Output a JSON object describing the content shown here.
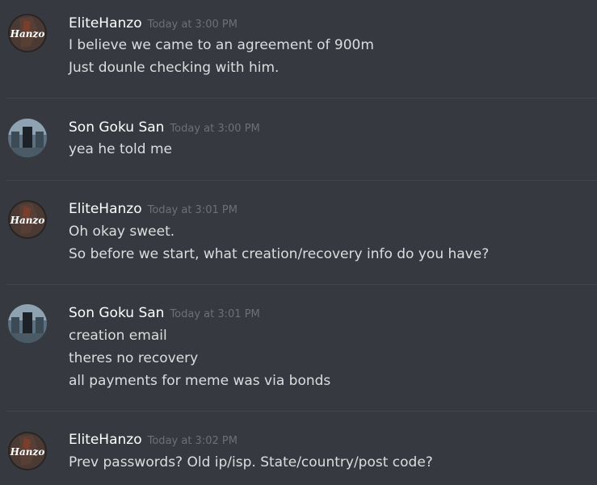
{
  "messages": [
    {
      "author": "EliteHanzo",
      "avatar_icon": "hanzo-avatar",
      "avatar_text": "Hanzo",
      "timestamp": "Today at 3:00 PM",
      "lines": [
        "I believe we came to an agreement of 900m",
        "Just dounle checking with him."
      ]
    },
    {
      "author": "Son Goku San",
      "avatar_icon": "goku-avatar",
      "timestamp": "Today at 3:00 PM",
      "lines": [
        "yea he told me"
      ]
    },
    {
      "author": "EliteHanzo",
      "avatar_icon": "hanzo-avatar",
      "avatar_text": "Hanzo",
      "timestamp": "Today at 3:01 PM",
      "lines": [
        "Oh okay sweet.",
        "So before we start, what creation/recovery info do you have?"
      ]
    },
    {
      "author": "Son Goku San",
      "avatar_icon": "goku-avatar",
      "timestamp": "Today at 3:01 PM",
      "lines": [
        "creation email",
        "theres no recovery",
        "all payments for meme was via bonds"
      ]
    },
    {
      "author": "EliteHanzo",
      "avatar_icon": "hanzo-avatar",
      "avatar_text": "Hanzo",
      "timestamp": "Today at 3:02 PM",
      "lines": [
        "Prev passwords? Old ip/isp. State/country/post code?"
      ]
    }
  ],
  "colors": {
    "background": "#36393f",
    "username": "#ffffff",
    "message_text": "#dcddde",
    "timestamp": "#6d7075",
    "divider": "#42454a"
  }
}
